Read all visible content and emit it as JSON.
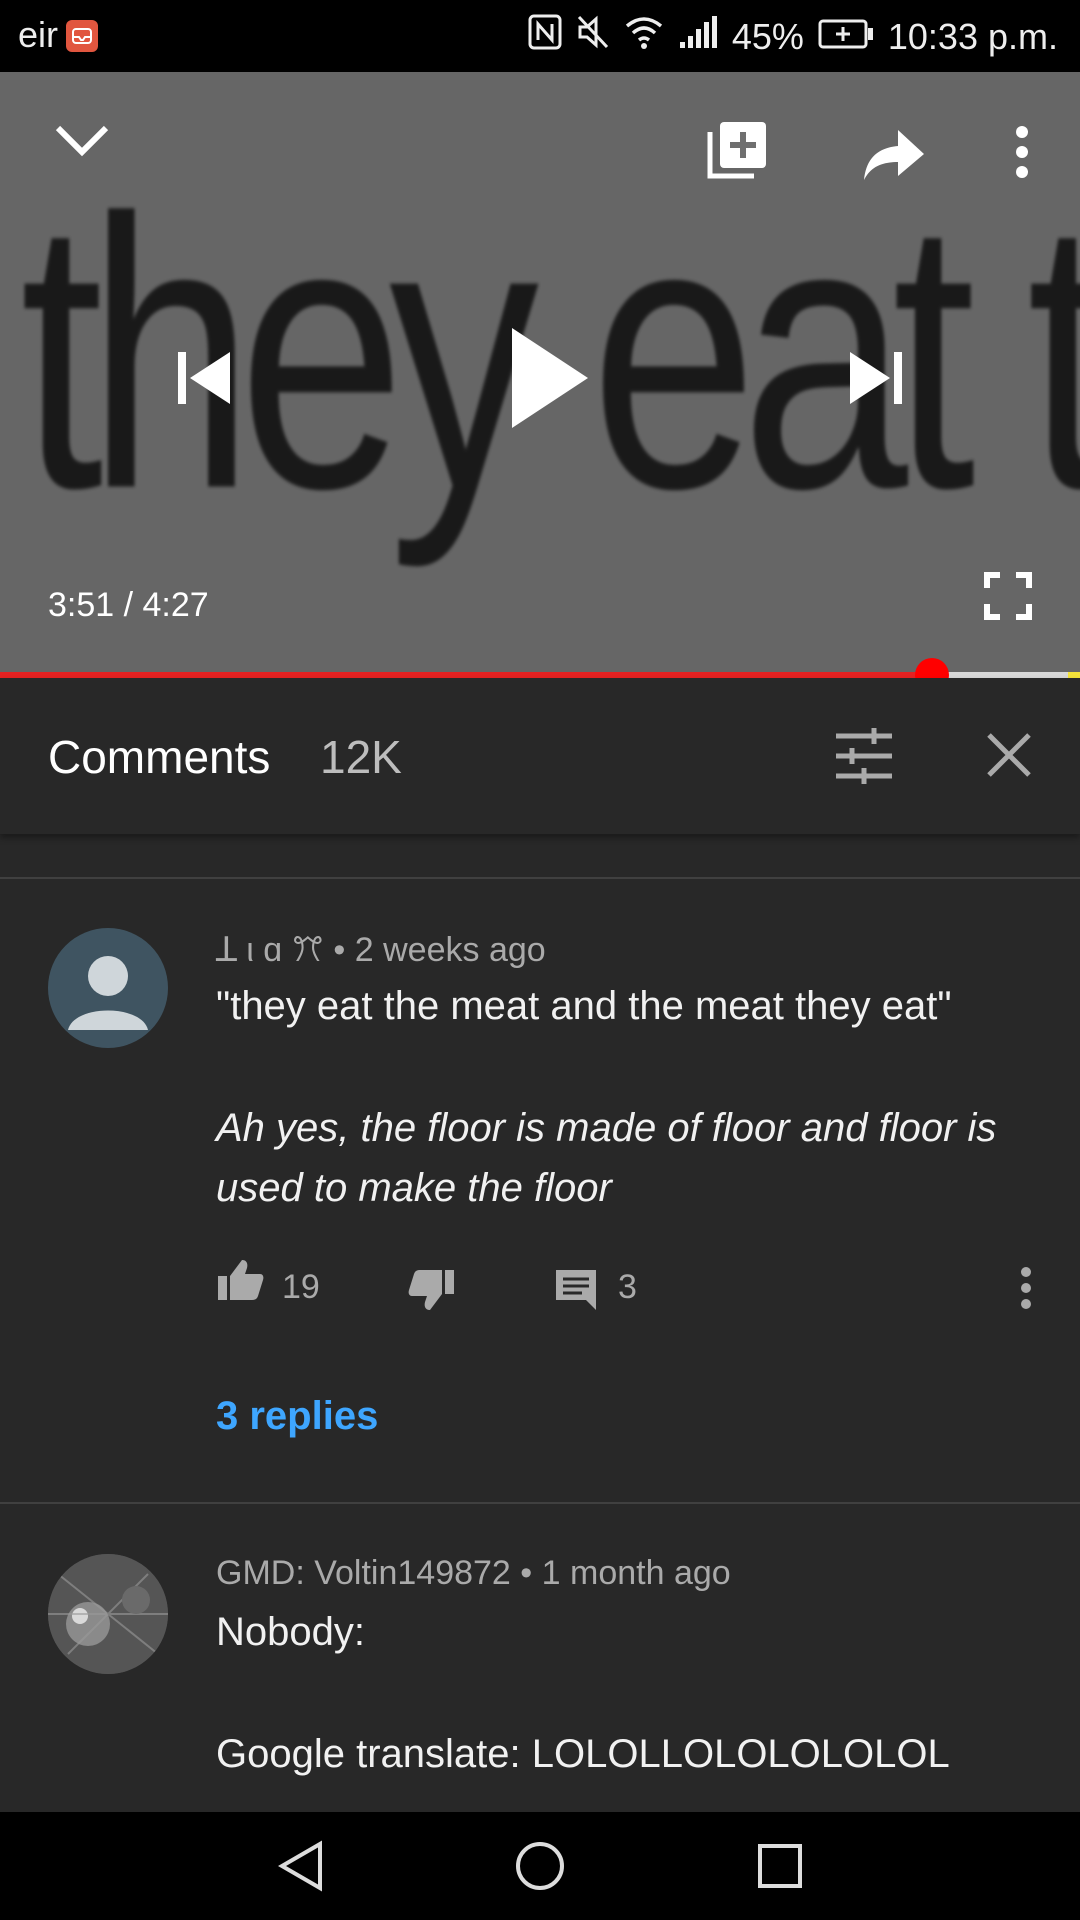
{
  "status_bar": {
    "carrier": "eir",
    "battery": "45%",
    "time": "10:33 p.m."
  },
  "video": {
    "frame_text": "they eat the baby",
    "time": "3:51 / 4:27",
    "progress": 0.863
  },
  "comments_header": {
    "title": "Comments",
    "count": "12K"
  },
  "comments": [
    {
      "author": "ꓕ ι ɑ ꔫ",
      "age": "2 weeks ago",
      "line1": "\"they eat the meat and the meat they eat\"",
      "line2": "Ah yes, the floor is made of floor and floor is",
      "line3": "used to make the floor",
      "likes": "19",
      "reply_count": "3",
      "replies_link": "3 replies"
    },
    {
      "author": "GMD: Voltin149872",
      "age": "1 month ago",
      "line1": "Nobody:",
      "line2": "Google translate: LOLOLLOLOLOLOLOL"
    }
  ],
  "colors": {
    "accent_red": "#ff0000",
    "link_blue": "#3ea6ff",
    "background": "#282828"
  }
}
